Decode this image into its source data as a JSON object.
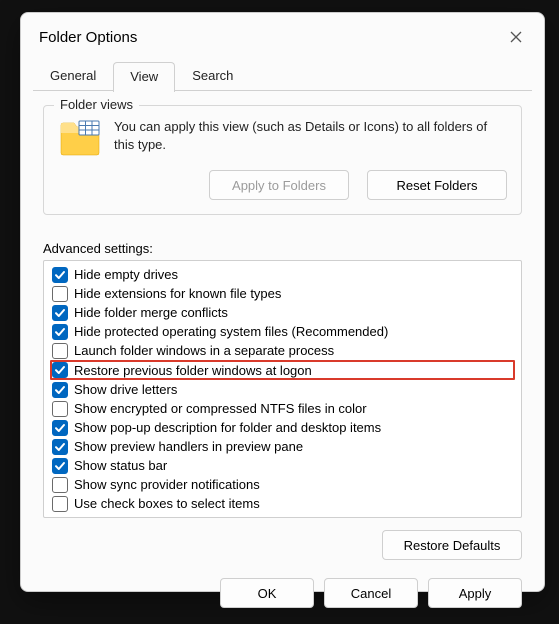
{
  "window": {
    "title": "Folder Options"
  },
  "tabs": {
    "general": "General",
    "view": "View",
    "search": "Search",
    "active": "view"
  },
  "folder_views": {
    "legend": "Folder views",
    "description": "You can apply this view (such as Details or Icons) to all folders of this type.",
    "apply_btn": "Apply to Folders",
    "reset_btn": "Reset Folders"
  },
  "advanced": {
    "label": "Advanced settings:",
    "items": [
      {
        "label": "Hide empty drives",
        "checked": true,
        "highlight": false
      },
      {
        "label": "Hide extensions for known file types",
        "checked": false,
        "highlight": false
      },
      {
        "label": "Hide folder merge conflicts",
        "checked": true,
        "highlight": false
      },
      {
        "label": "Hide protected operating system files (Recommended)",
        "checked": true,
        "highlight": false
      },
      {
        "label": "Launch folder windows in a separate process",
        "checked": false,
        "highlight": false
      },
      {
        "label": "Restore previous folder windows at logon",
        "checked": true,
        "highlight": true
      },
      {
        "label": "Show drive letters",
        "checked": true,
        "highlight": false
      },
      {
        "label": "Show encrypted or compressed NTFS files in color",
        "checked": false,
        "highlight": false
      },
      {
        "label": "Show pop-up description for folder and desktop items",
        "checked": true,
        "highlight": false
      },
      {
        "label": "Show preview handlers in preview pane",
        "checked": true,
        "highlight": false
      },
      {
        "label": "Show status bar",
        "checked": true,
        "highlight": false
      },
      {
        "label": "Show sync provider notifications",
        "checked": false,
        "highlight": false
      },
      {
        "label": "Use check boxes to select items",
        "checked": false,
        "highlight": false
      }
    ]
  },
  "restore_defaults": "Restore Defaults",
  "footer": {
    "ok": "OK",
    "cancel": "Cancel",
    "apply": "Apply"
  }
}
